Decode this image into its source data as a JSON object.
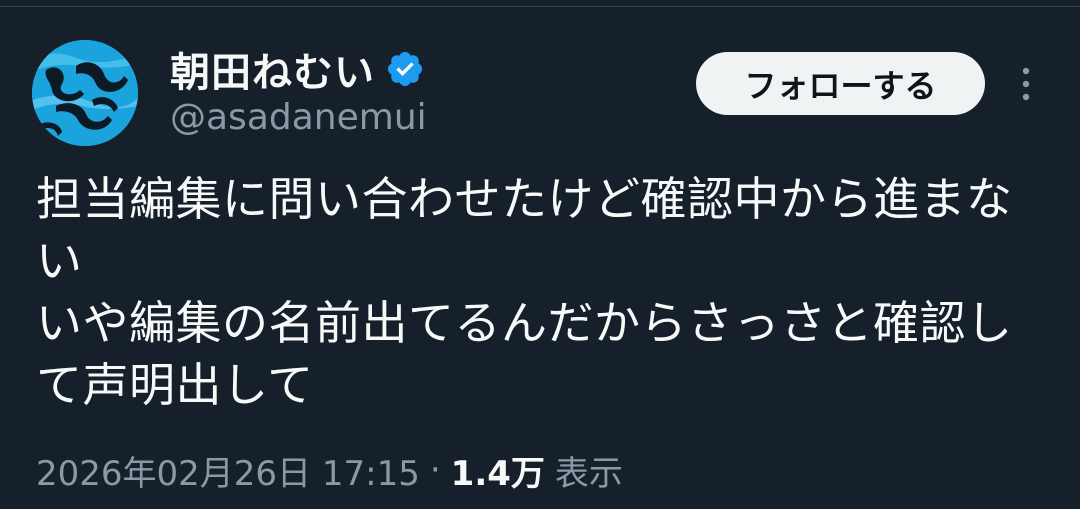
{
  "colors": {
    "background": "#15202b",
    "text_primary": "#f7f9f9",
    "text_secondary": "#8b98a5",
    "verified_badge": "#1d9bf0",
    "follow_button_bg": "#eff3f4",
    "follow_button_text": "#0f1419"
  },
  "author": {
    "display_name": "朝田ねむい",
    "handle": "@asadanemui",
    "verified": true,
    "avatar_icon": "avatar-image",
    "verified_icon": "verified-badge-icon"
  },
  "actions": {
    "follow_label": "フォローする",
    "more_icon": "more-options-icon"
  },
  "tweet": {
    "text": "担当編集に問い合わせたけど確認中から進まない\nいや編集の名前出てるんだからさっさと確認して声明出して"
  },
  "meta": {
    "timestamp": "2026年02月26日 17:15",
    "separator": "·",
    "view_count": "1.4万",
    "views_label": "表示"
  }
}
